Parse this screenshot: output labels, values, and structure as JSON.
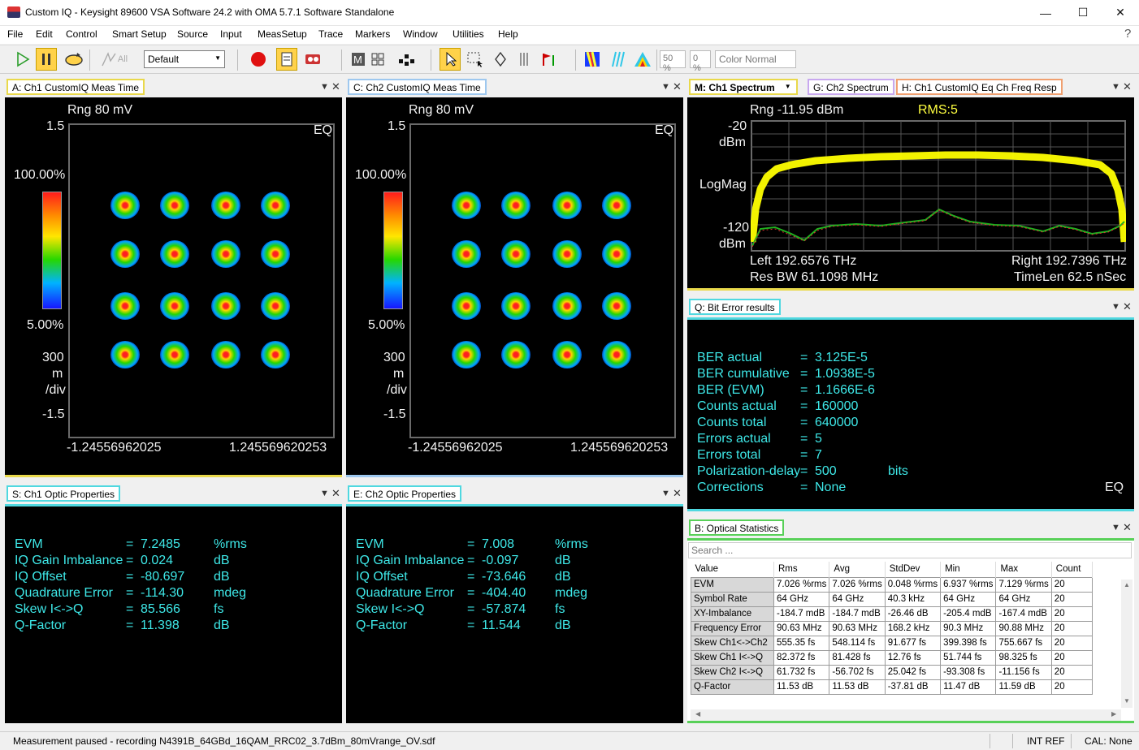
{
  "window": {
    "title": "Custom IQ - Keysight 89600 VSA Software 24.2 with OMA 5.7.1 Software Standalone",
    "help": "?"
  },
  "menu": [
    "File",
    "Edit",
    "Control",
    "Smart Setup",
    "Source",
    "Input",
    "MeasSetup",
    "Trace",
    "Markers",
    "Window",
    "Utilities",
    "Help"
  ],
  "toolbar": {
    "all_label": "All",
    "preset": "Default",
    "zoom1": "50 %",
    "zoom2": "0 %",
    "color_mode": "Color Normal"
  },
  "paneA": {
    "tab": "A: Ch1 CustomIQ Meas Time",
    "rng": "Rng 80 mV",
    "eq": "EQ",
    "y_top": "1.5",
    "y_bot": "-1.5",
    "cb_top": "100.00%",
    "cb_bot": "5.00%",
    "div1": "300",
    "div2": "m",
    "div3": "/div",
    "x_left": "-1.24556962025",
    "x_right": "1.245569620253"
  },
  "paneC": {
    "tab": "C: Ch2 CustomIQ Meas Time",
    "rng": "Rng 80 mV",
    "eq": "EQ",
    "y_top": "1.5",
    "y_bot": "-1.5",
    "cb_top": "100.00%",
    "cb_bot": "5.00%",
    "div1": "300",
    "div2": "m",
    "div3": "/div",
    "x_left": "-1.24556962025",
    "x_right": "1.245569620253"
  },
  "paneM": {
    "tabs": [
      "M: Ch1 Spectrum",
      "G: Ch2 Spectrum",
      "H: Ch1 CustomIQ Eq Ch Freq Resp"
    ],
    "rng": "Rng -11.95 dBm",
    "rms": "RMS:5",
    "y_top": "-20",
    "y_unit": "dBm",
    "y_mid": "LogMag",
    "y_bot": "-120",
    "y_unit2": "dBm",
    "left": "Left 192.6576 THz",
    "right": "Right 192.7396 THz",
    "resbw": "Res BW 61.1098 MHz",
    "timelen": "TimeLen 62.5 nSec"
  },
  "paneQ": {
    "tab": "Q: Bit Error results",
    "eq": "EQ",
    "rows": [
      {
        "label": "BER actual",
        "eq": "=",
        "value": "3.125E-5",
        "unit": ""
      },
      {
        "label": "BER cumulative",
        "eq": "=",
        "value": "1.0938E-5",
        "unit": ""
      },
      {
        "label": "BER (EVM)",
        "eq": "=",
        "value": "1.1666E-6",
        "unit": ""
      },
      {
        "label": "Counts actual",
        "eq": "=",
        "value": "160000",
        "unit": ""
      },
      {
        "label": "Counts total",
        "eq": "=",
        "value": "640000",
        "unit": ""
      },
      {
        "label": "Errors actual",
        "eq": "=",
        "value": "5",
        "unit": ""
      },
      {
        "label": "Errors total",
        "eq": "=",
        "value": "7",
        "unit": ""
      },
      {
        "label": "Polarization-delay",
        "eq": "=",
        "value": "500",
        "unit": "bits"
      },
      {
        "label": "Corrections",
        "eq": "=",
        "value": "None",
        "unit": ""
      }
    ]
  },
  "paneS": {
    "tab": "S: Ch1 Optic Properties",
    "rows": [
      {
        "label": "EVM",
        "eq": "=",
        "value": "7.2485",
        "unit": "%rms"
      },
      {
        "label": "IQ Gain Imbalance",
        "eq": "=",
        "value": "0.024",
        "unit": "dB"
      },
      {
        "label": "IQ Offset",
        "eq": "=",
        "value": "-80.697",
        "unit": "dB"
      },
      {
        "label": "Quadrature Error",
        "eq": "=",
        "value": "-114.30",
        "unit": "mdeg"
      },
      {
        "label": "Skew I<->Q",
        "eq": "=",
        "value": "85.566",
        "unit": "fs"
      },
      {
        "label": "Q-Factor",
        "eq": "=",
        "value": "11.398",
        "unit": "dB"
      }
    ]
  },
  "paneE": {
    "tab": "E: Ch2 Optic Properties",
    "rows": [
      {
        "label": "EVM",
        "eq": "=",
        "value": "7.008",
        "unit": "%rms"
      },
      {
        "label": "IQ Gain Imbalance",
        "eq": "=",
        "value": "-0.097",
        "unit": "dB"
      },
      {
        "label": "IQ Offset",
        "eq": "=",
        "value": "-73.646",
        "unit": "dB"
      },
      {
        "label": "Quadrature Error",
        "eq": "=",
        "value": "-404.40",
        "unit": "mdeg"
      },
      {
        "label": "Skew I<->Q",
        "eq": "=",
        "value": "-57.874",
        "unit": "fs"
      },
      {
        "label": "Q-Factor",
        "eq": "=",
        "value": "11.544",
        "unit": "dB"
      }
    ]
  },
  "paneB": {
    "tab": "B: Optical Statistics",
    "search_placeholder": "Search ...",
    "headers": [
      "Value",
      "Rms",
      "Avg",
      "StdDev",
      "Min",
      "Max",
      "Count"
    ],
    "rows": [
      [
        "EVM",
        "7.026 %rms",
        "7.026 %rms",
        "0.048 %rms",
        "6.937 %rms",
        "7.129 %rms",
        "20"
      ],
      [
        "Symbol Rate",
        "64 GHz",
        "64 GHz",
        "40.3 kHz",
        "64 GHz",
        "64 GHz",
        "20"
      ],
      [
        "XY-Imbalance",
        "-184.7 mdB",
        "-184.7 mdB",
        "-26.46 dB",
        "-205.4 mdB",
        "-167.4 mdB",
        "20"
      ],
      [
        "Frequency Error",
        "90.63 MHz",
        "90.63 MHz",
        "168.2 kHz",
        "90.3 MHz",
        "90.88 MHz",
        "20"
      ],
      [
        "Skew Ch1<->Ch2",
        "555.35 fs",
        "548.114 fs",
        "91.677 fs",
        "399.398 fs",
        "755.667 fs",
        "20"
      ],
      [
        "Skew Ch1 I<->Q",
        "82.372 fs",
        "81.428 fs",
        "12.76 fs",
        "51.744 fs",
        "98.325 fs",
        "20"
      ],
      [
        "Skew Ch2 I<->Q",
        "61.732 fs",
        "-56.702 fs",
        "25.042 fs",
        "-93.308 fs",
        "-11.156 fs",
        "20"
      ],
      [
        "Q-Factor",
        "11.53 dB",
        "11.53 dB",
        "-37.81 dB",
        "11.47 dB",
        "11.59 dB",
        "20"
      ]
    ]
  },
  "status": {
    "message": "Measurement paused - recording N4391B_64GBd_16QAM_RRC02_3.7dBm_80mVrange_OV.sdf",
    "ref": "INT REF",
    "cal": "CAL: None"
  }
}
